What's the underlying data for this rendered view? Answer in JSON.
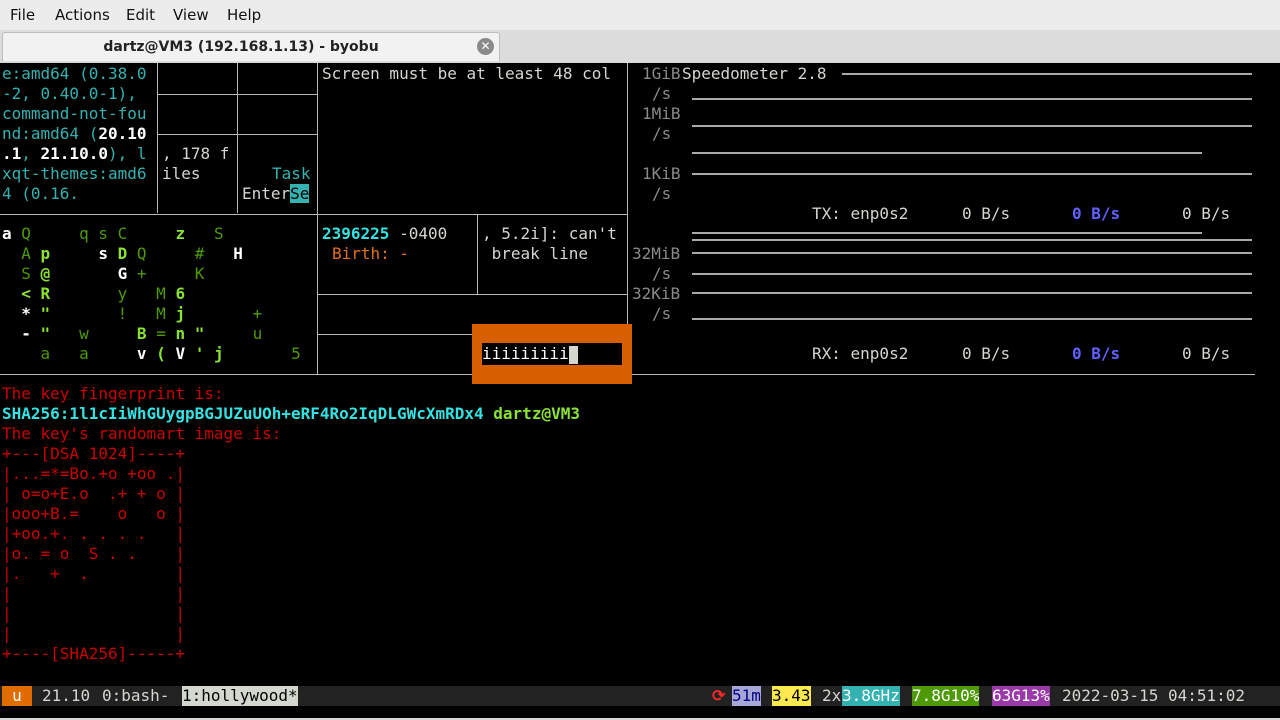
{
  "menu": [
    "File",
    "Actions",
    "Edit",
    "View",
    "Help"
  ],
  "window": {
    "tab_title": "dartz@VM3 (192.168.1.13) - byobu"
  },
  "pane1": {
    "lines": [
      "e:amd64 (0.38.0",
      "-2, 0.40.0-1),",
      "command-not-fou",
      "nd:amd64 (",
      ".1",
      ", 21.10.0), l",
      "xqt-themes:amd6",
      "4 (0.16."
    ],
    "bold_a": "20.10",
    "bold_b": "21.10.0"
  },
  "pane2": {
    "line1": ", 178 f",
    "line2": "iles",
    "task": "Task",
    "enter": "Enter",
    "se": "Se"
  },
  "pane_top": "Screen must be at least 48 col",
  "matrix": {
    "rows": [
      "a Q     q s C     z   S",
      "  A p     s D Q     #   H",
      "  S @       G +     K",
      "  < R       y   M 6",
      "  * \"       !   M j       +",
      "  - \"   w     B = n \"     u",
      "    a   a     v ( V ' j       5"
    ]
  },
  "stat": {
    "line1": "2396225",
    "tz": "-0400",
    "birth_label": "Birth: -"
  },
  "err": {
    "line1": ", 5.2i]: can't",
    "line2": " break line"
  },
  "popup": {
    "text": "iiiiiiiii"
  },
  "speed": {
    "title": "Speedometer 2.8",
    "scale": [
      "1GiB",
      "/s",
      "1MiB",
      "/s",
      "1KiB",
      "/s",
      "32MiB",
      "/s",
      "32KiB",
      "/s"
    ],
    "tx": {
      "label": "TX: enp0s2",
      "v1": "0 B/s",
      "v2": "0 B/s",
      "v3": "0 B/s"
    },
    "rx": {
      "label": "RX: enp0s2",
      "v1": "0 B/s",
      "v2": "0 B/s",
      "v3": "0 B/s"
    }
  },
  "ssh": {
    "fingerprint_label": "The key fingerprint is:",
    "fingerprint": "SHA256:1l1cIiWhGUygpBGJUZuUOh+eRF4Ro2IqDLGWcXmRDx4",
    "user": "dartz@VM3",
    "randomart_label": "The key's randomart image is:",
    "art": [
      "+---[DSA 1024]----+",
      "|...=*=Bo.+o +oo .|",
      "| o=o+E.o  .+ + o |",
      "|ooo+B.=    o   o |",
      "|+oo.+. . . . .   |",
      "|o. = o  S . .    |",
      "|.   +  .         |",
      "|                 |",
      "|                 |",
      "|                 |",
      "+----[SHA256]-----+"
    ]
  },
  "statusbar": {
    "u": "u",
    "release": "21.10",
    "win0": "0:bash-",
    "win1": "1:hollywood*",
    "reboot_icon": "⟳",
    "uptime": "51m",
    "load": "3.43",
    "cpu_count": "2x",
    "cpu_freq": "3.8GHz",
    "mem": "7.8G10%",
    "disk": "63G13%",
    "datetime": "2022-03-15 04:51:02"
  },
  "colors": {
    "accent_orange": "#d85f00",
    "terminal_bg": "#000000",
    "cyan": "#34e2e2",
    "green": "#8ae234",
    "red": "#cc0000"
  }
}
